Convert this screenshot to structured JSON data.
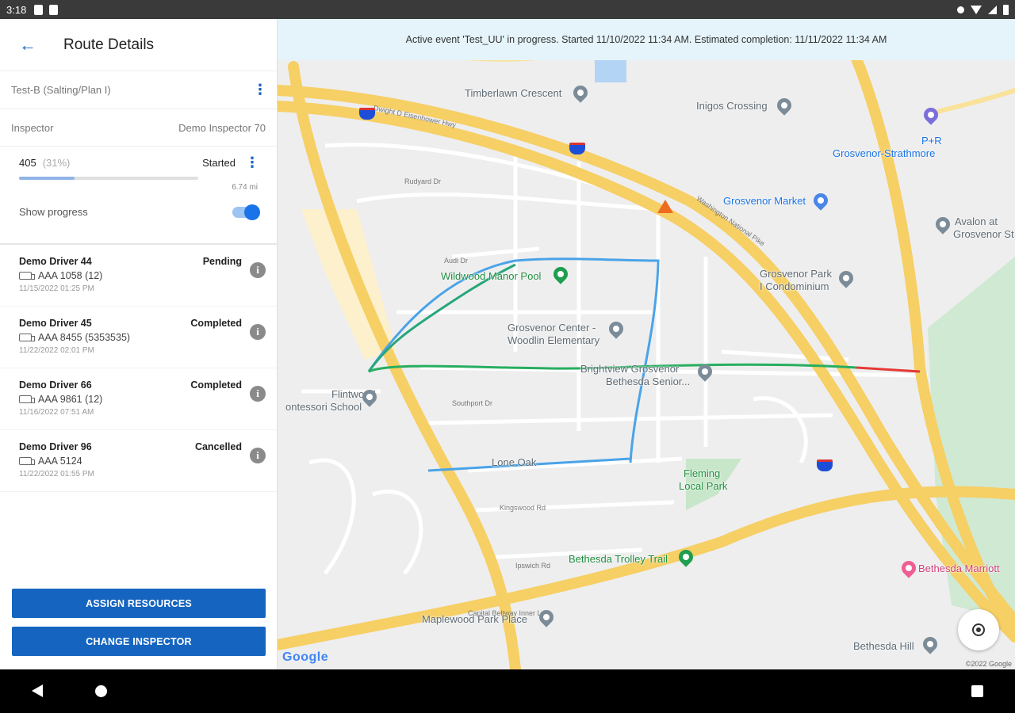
{
  "status_bar": {
    "time": "3:18"
  },
  "header": {
    "title": "Route Details"
  },
  "route": {
    "plan_name": "Test-B (Salting/Plan I)",
    "inspector_label": "Inspector",
    "inspector_value": "Demo Inspector 70",
    "number": "405",
    "percent": "(31%)",
    "status": "Started",
    "progress_fraction": 0.31,
    "distance": "6.74 mi",
    "show_progress_label": "Show progress",
    "show_progress_on": true
  },
  "drivers": [
    {
      "name": "Demo Driver 44",
      "status": "Pending",
      "vehicle": "AAA 1058 (12)",
      "time": "11/15/2022 01:25 PM"
    },
    {
      "name": "Demo Driver 45",
      "status": "Completed",
      "vehicle": "AAA 8455 (5353535)",
      "time": "11/22/2022 02:01 PM"
    },
    {
      "name": "Demo Driver 66",
      "status": "Completed",
      "vehicle": "AAA 9861 (12)",
      "time": "11/16/2022 07:51 AM"
    },
    {
      "name": "Demo Driver 96",
      "status": "Cancelled",
      "vehicle": "AAA 5124",
      "time": "11/22/2022 01:55 PM"
    }
  ],
  "buttons": {
    "assign": "ASSIGN RESOURCES",
    "change": "CHANGE INSPECTOR"
  },
  "map": {
    "banner": "Active event 'Test_UU' in progress. Started 11/10/2022 11:34 AM. Estimated completion: 11/11/2022 11:34 AM",
    "places": {
      "timberlawn": "Timberlawn Crescent",
      "inigos": "Inigos Crossing",
      "pf_line1": "P+R",
      "pf_line2": "Grosvenor-Strathmore",
      "grosvenor_market": "Grosvenor Market",
      "avalon_line1": "Avalon at",
      "avalon_line2": "Grosvenor St",
      "wildwood": "Wildwood Manor Pool",
      "grosvenor_park_line1": "Grosvenor Park",
      "grosvenor_park_line2": "I Condominium",
      "grosvenor_center_line1": "Grosvenor Center -",
      "grosvenor_center_line2": "Woodlin Elementary",
      "brightview_line1": "Brightview Grosvenor",
      "brightview_line2": "Bethesda Senior...",
      "flintwood_line1": "Flintwood",
      "flintwood_line2": "ontessori School",
      "lone_oak": "Lone Oak",
      "fleming_line1": "Fleming",
      "fleming_line2": "Local Park",
      "bethesda_trolley": "Bethesda Trolley Trail",
      "bethesda_marriott": "Bethesda Marriott",
      "maplewood": "Maplewood Park Place",
      "bethesda_hill": "Bethesda Hill"
    },
    "google": "Google",
    "copyright": "©2022 Google"
  },
  "colors": {
    "accent": "#1565c0",
    "highway": "#f6cf65",
    "route_blue": "#4aa3e8",
    "route_green": "#27ae60",
    "route_red": "#e53935",
    "banner_bg": "#e5f4fb"
  }
}
